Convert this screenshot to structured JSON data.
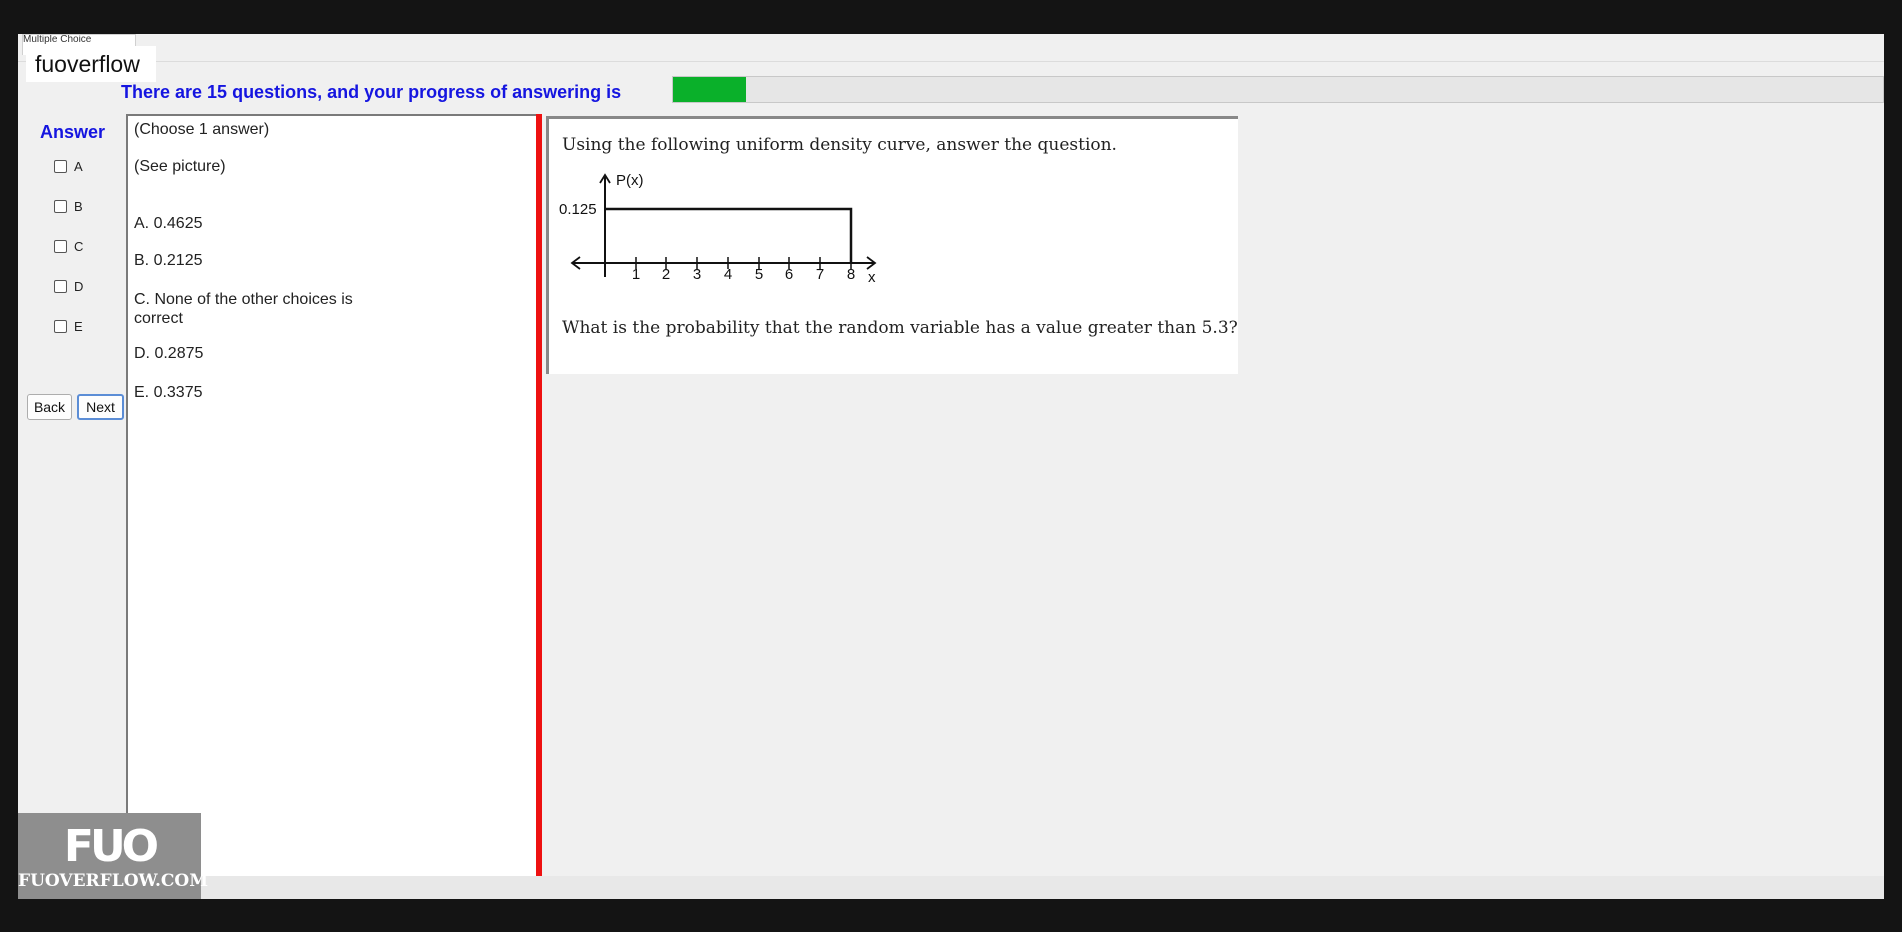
{
  "window": {
    "tab_title": "Multiple Choice"
  },
  "watermark_title": "fuoverflow",
  "progress": {
    "text": "There are 15 questions, and your progress of answering is",
    "fraction": 0.06,
    "fill_color": "#0ab02a"
  },
  "answer": {
    "label": "Answer",
    "options": [
      "A",
      "B",
      "C",
      "D",
      "E"
    ]
  },
  "nav": {
    "back_label": "Back",
    "next_label": "Next"
  },
  "choices": {
    "instruction": "(Choose 1 answer)",
    "see_picture": "(See picture)",
    "items": [
      "A.  0.4625",
      "B.  0.2125",
      "C.  None of the other choices is",
      "correct",
      "D.  0.2875",
      "E.  0.3375"
    ]
  },
  "question": {
    "intro": "Using the following uniform density curve, answer the question.",
    "prompt": "What is the probability that the random variable has a value greater than 5.3?",
    "graph": {
      "y_label": "P(x)",
      "y_tick": "0.125",
      "x_label": "x",
      "x_ticks": [
        "1",
        "2",
        "3",
        "4",
        "5",
        "6",
        "7",
        "8"
      ]
    }
  },
  "logo": {
    "mark": "FUO",
    "site": "FUOVERFLOW.COM"
  },
  "colors": {
    "accent_text": "#1515e0",
    "divider": "#ee1111"
  }
}
